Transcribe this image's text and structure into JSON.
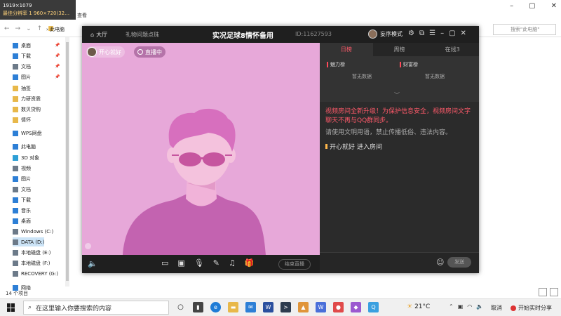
{
  "explorer": {
    "resolution_badge": "1919×1079",
    "resolution_sub": "最佳分辨率 1 960×720(32…",
    "menu_view": "查看",
    "address": "此电脑",
    "search_placeholder": "搜索\"此电脑\"",
    "status_items": "14 个项目",
    "sidebar": [
      {
        "label": "桌面",
        "icon": "desktop-icon",
        "color": "#2d7fd6",
        "pinned": true
      },
      {
        "label": "下载",
        "icon": "download-icon",
        "color": "#2d7fd6",
        "pinned": true
      },
      {
        "label": "文档",
        "icon": "document-icon",
        "color": "#6c7a89",
        "pinned": true
      },
      {
        "label": "图片",
        "icon": "picture-icon",
        "color": "#2d7fd6",
        "pinned": true
      },
      {
        "label": "抽签",
        "icon": "folder-icon",
        "color": "#e8b84a",
        "pinned": false
      },
      {
        "label": "力研资质",
        "icon": "folder-icon",
        "color": "#e8b84a",
        "pinned": false
      },
      {
        "label": "数贝贷购",
        "icon": "folder-icon",
        "color": "#e8b84a",
        "pinned": false
      },
      {
        "label": "情怀",
        "icon": "folder-icon",
        "color": "#e8b84a",
        "pinned": false
      },
      {
        "label": "WPS网盘",
        "icon": "cloud-icon",
        "color": "#2d7fd6",
        "pinned": false
      },
      {
        "label": "此电脑",
        "icon": "computer-icon",
        "color": "#2d7fd6",
        "pinned": false
      },
      {
        "label": "3D 对象",
        "icon": "cube-icon",
        "color": "#2d9fd6",
        "pinned": false
      },
      {
        "label": "视频",
        "icon": "video-icon",
        "color": "#6c7a89",
        "pinned": false
      },
      {
        "label": "图片",
        "icon": "picture-icon",
        "color": "#2d7fd6",
        "pinned": false
      },
      {
        "label": "文档",
        "icon": "document-icon",
        "color": "#6c7a89",
        "pinned": false
      },
      {
        "label": "下载",
        "icon": "download-icon",
        "color": "#2d7fd6",
        "pinned": false
      },
      {
        "label": "音乐",
        "icon": "music-icon",
        "color": "#2d7fd6",
        "pinned": false
      },
      {
        "label": "桌面",
        "icon": "desktop-icon",
        "color": "#2d7fd6",
        "pinned": false
      },
      {
        "label": "Windows (C:)",
        "icon": "drive-icon",
        "color": "#6c7a89",
        "pinned": false
      },
      {
        "label": "DATA (D:)",
        "icon": "drive-icon",
        "color": "#6c7a89",
        "pinned": false
      },
      {
        "label": "本地磁盘 (E:)",
        "icon": "drive-icon",
        "color": "#6c7a89",
        "pinned": false
      },
      {
        "label": "本地磁盘 (F:)",
        "icon": "drive-icon",
        "color": "#6c7a89",
        "pinned": false
      },
      {
        "label": "RECOVERY (G:)",
        "icon": "drive-icon",
        "color": "#6c7a89",
        "pinned": false
      },
      {
        "label": "网络",
        "icon": "network-icon",
        "color": "#2d7fd6",
        "pinned": false
      }
    ]
  },
  "app": {
    "tab_hall": "大厅",
    "tab_gift": "礼物问题点珠",
    "room_title": "实况足球8情怀备用",
    "room_id": "ID:11627593",
    "theme_mode": "妄序模式",
    "host_name": "开心就好",
    "live_status": "直播中",
    "close_live": "结束直播",
    "rank_tabs": [
      {
        "label": "日榜",
        "active": true
      },
      {
        "label": "周榜",
        "active": false
      },
      {
        "label": "在线3",
        "active": false
      }
    ],
    "charm_rank": "魅力榜",
    "wealth_rank": "财富榜",
    "no_data": "暂无数据",
    "chat_notice": "视频房间全新升级！为保护信息安全，视频房间文字聊天不再与QQ群同步。",
    "chat_rules": "请使用文明用语，禁止传播低俗、违法内容。",
    "enter_user": "开心就好",
    "enter_text": "进入房间",
    "send_label": "发送",
    "accent": "#ff5a6a"
  },
  "taskbar": {
    "search_placeholder": "在这里输入你要搜索的内容",
    "temperature": "21°C",
    "cancel": "取消",
    "live_button": "开始实时分享"
  }
}
